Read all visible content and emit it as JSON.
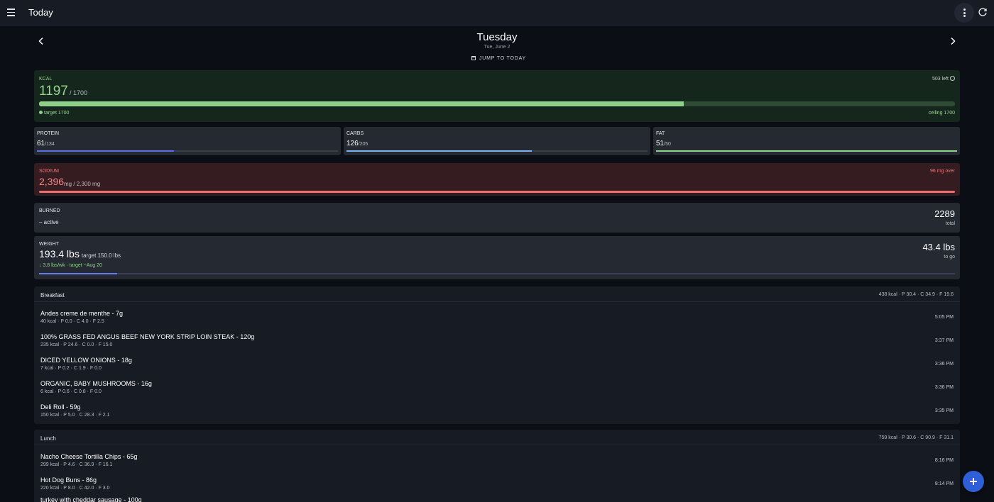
{
  "app": {
    "title": "Today"
  },
  "day": {
    "name": "Tuesday",
    "date": "Tue, June 2",
    "jump_label": "JUMP TO TODAY"
  },
  "kcal": {
    "label": "KCAL",
    "value": "1197",
    "of": "/ 1700",
    "left": "503 left",
    "progress": 0.704,
    "target": "target 1700",
    "ceiling": "ceiling 1700",
    "color": "#8fd18a"
  },
  "macros": [
    {
      "name": "PROTEIN",
      "value": "61",
      "goal": "/134",
      "progress": 0.455,
      "color": "#5b6fe0"
    },
    {
      "name": "CARBS",
      "value": "126",
      "goal": "/205",
      "progress": 0.615,
      "color": "#7fb0f0"
    },
    {
      "name": "FAT",
      "value": "51",
      "goal": "/50",
      "progress": 1.0,
      "color": "#8fd18a"
    }
  ],
  "sodium": {
    "label": "SODIUM",
    "value": "2,396",
    "unit": "mg / 2,300 mg",
    "over": "96 mg over",
    "progress": 1.0,
    "color": "#ec6f71"
  },
  "burned": {
    "label": "BURNED",
    "active": "– active",
    "total": "2289",
    "total_label": "total"
  },
  "weight": {
    "label": "WEIGHT",
    "value": "193.4 lbs",
    "target": "· target 150.0 lbs",
    "rate": "↓ 3.8 lbs/wk · target ~Aug 20",
    "to_go": "43.4 lbs",
    "to_go_label": "to go",
    "progress": 0.085
  },
  "meals": [
    {
      "name": "Breakfast",
      "totals": "438 kcal · P 30.4 · C 34.9 · F 19.6",
      "items": [
        {
          "title": "Andes creme de menthe - 7g",
          "sub": "40 kcal · P 0.0 · C 4.0 · F 2.5",
          "time": "5:05 PM"
        },
        {
          "title": "100% GRASS FED ANGUS BEEF NEW YORK STRIP LOIN STEAK - 120g",
          "sub": "235 kcal · P 24.6 · C 0.0 · F 15.0",
          "time": "3:37 PM"
        },
        {
          "title": "DICED YELLOW ONIONS - 18g",
          "sub": "7 kcal · P 0.2 · C 1.9 · F 0.0",
          "time": "3:36 PM"
        },
        {
          "title": "ORGANIC, BABY MUSHROOMS - 16g",
          "sub": "6 kcal · P 0.6 · C 0.8 · F 0.0",
          "time": "3:36 PM"
        },
        {
          "title": "Deli Roll - 59g",
          "sub": "150 kcal · P 5.0 · C 28.3 · F 2.1",
          "time": "3:35 PM"
        }
      ]
    },
    {
      "name": "Lunch",
      "totals": "759 kcal · P 30.6 · C 90.9 · F 31.1",
      "items": [
        {
          "title": "Nacho Cheese Tortilla Chips - 65g",
          "sub": "299 kcal · P 4.6 · C 36.9 · F 16.1",
          "time": "8:16 PM"
        },
        {
          "title": "Hot Dog Buns - 86g",
          "sub": "220 kcal · P 8.0 · C 42.0 · F 3.0",
          "time": "8:14 PM"
        },
        {
          "title": "turkey with cheddar sausage - 100g",
          "sub": "",
          "time": ""
        }
      ]
    }
  ],
  "fab": {
    "icon": "plus-icon"
  }
}
